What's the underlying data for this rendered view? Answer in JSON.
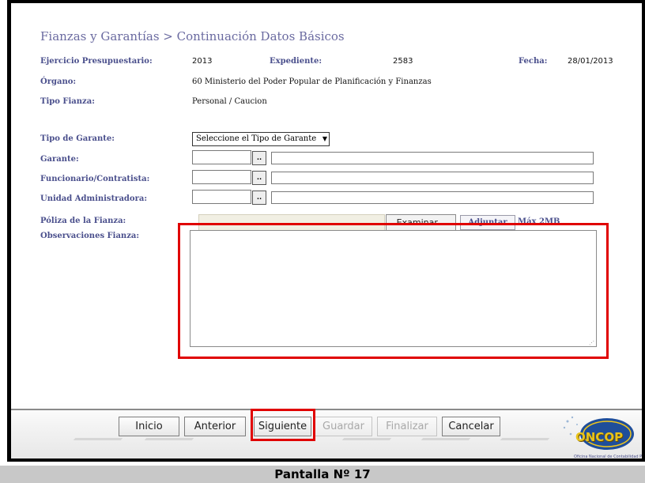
{
  "heading": "Fianzas y Garantías > Continuación Datos Básicos",
  "info": {
    "ejercicio_label": "Ejercicio Presupuestario:",
    "ejercicio_value": "2013",
    "expediente_label": "Expediente:",
    "expediente_value": "2583",
    "fecha_label": "Fecha:",
    "fecha_value": "28/01/2013",
    "organo_label": "Órgano:",
    "organo_value": "60 Ministerio del Poder Popular de Planificación y Finanzas",
    "tipo_fianza_label": "Tipo Fianza:",
    "tipo_fianza_value": "Personal / Caucion"
  },
  "form": {
    "tipo_garante_label": "Tipo de Garante:",
    "tipo_garante_selected": "Seleccione el Tipo de Garante",
    "garante_label": "Garante:",
    "funcionario_label": "Funcionario/Contratista:",
    "unidad_label": "Unidad Administradora:",
    "lookup_label": "..",
    "poliza_label": "Póliza de la Fianza:",
    "examinar_label": "Examinar...",
    "adjuntar_label": "Adjuntar",
    "max_size": "Máx 2MB",
    "observaciones_label": "Observaciones Fianza:"
  },
  "nav": {
    "inicio": "Inicio",
    "anterior": "Anterior",
    "siguiente": "Siguiente",
    "guardar": "Guardar",
    "finalizar": "Finalizar",
    "cancelar": "Cancelar"
  },
  "logo": {
    "word": "ONCOP",
    "org": "Oficina Nacional de Contabilidad Pública"
  },
  "caption": "Pantalla Nº 17",
  "colors": {
    "label": "#4a4f8c",
    "heading": "#6a6aa0",
    "highlight": "#e00000"
  }
}
